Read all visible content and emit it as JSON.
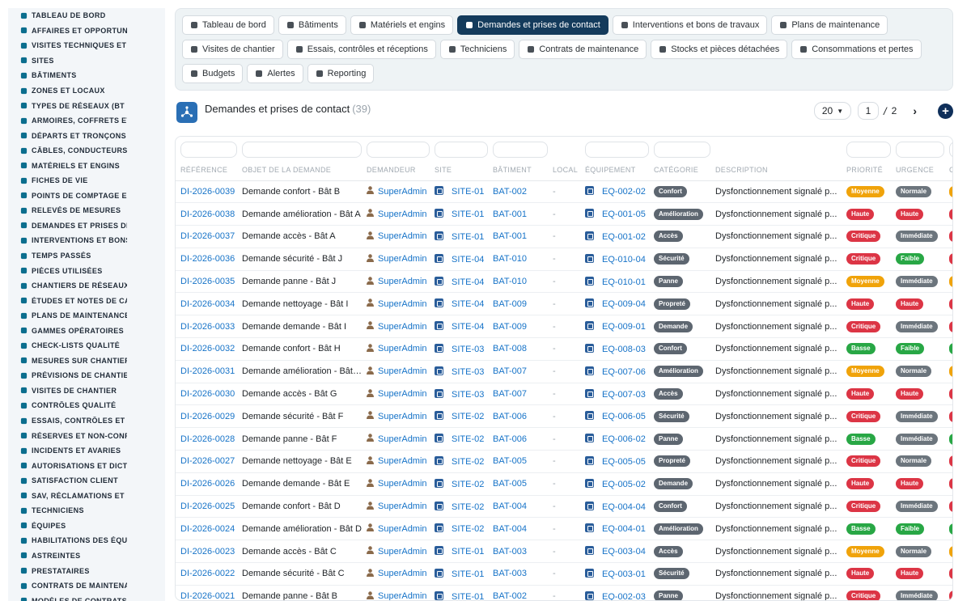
{
  "sidebar": {
    "items": [
      {
        "label": "TABLEAU DE BORD",
        "icon": "gauge-icon"
      },
      {
        "label": "AFFAIRES ET OPPORTUNITÉS",
        "icon": "target-icon"
      },
      {
        "label": "VISITES TECHNIQUES ET AUDITS",
        "icon": "clipboard-icon"
      },
      {
        "label": "SITES",
        "icon": "map-pin-icon"
      },
      {
        "label": "BÂTIMENTS",
        "icon": "building-icon"
      },
      {
        "label": "ZONES ET LOCAUX",
        "icon": "grid-icon"
      },
      {
        "label": "TYPES DE RÉSEAUX (BT / HTA)",
        "icon": "network-icon"
      },
      {
        "label": "ARMOIRES, COFFRETS ET TGBT",
        "icon": "cabinet-icon"
      },
      {
        "label": "DÉPARTS ET TRONÇONS",
        "icon": "route-icon"
      },
      {
        "label": "CÂBLES, CONDUCTEURS",
        "icon": "cable-icon"
      },
      {
        "label": "MATÉRIELS ET ENGINS",
        "icon": "gears-icon"
      },
      {
        "label": "FICHES DE VIE",
        "icon": "file-icon"
      },
      {
        "label": "POINTS DE COMPTAGE ET MESURE",
        "icon": "counter-icon"
      },
      {
        "label": "RELEVÉS DE MESURES",
        "icon": "chart-icon"
      },
      {
        "label": "DEMANDES ET PRISES DE CONTACT",
        "icon": "inbox-icon"
      },
      {
        "label": "INTERVENTIONS ET BONS DE TRAVAUX",
        "icon": "wrench-icon"
      },
      {
        "label": "TEMPS PASSÉS",
        "icon": "clock-icon"
      },
      {
        "label": "PIÈCES UTILISÉES",
        "icon": "box-icon"
      },
      {
        "label": "CHANTIERS DE RÉSEAUX",
        "icon": "hammer-icon"
      },
      {
        "label": "ÉTUDES ET NOTES DE CALCUL",
        "icon": "pencil-icon"
      },
      {
        "label": "PLANS DE MAINTENANCE",
        "icon": "calendar-icon"
      },
      {
        "label": "GAMMES OPÉRATOIRES",
        "icon": "list-icon"
      },
      {
        "label": "CHECK-LISTS QUALITÉ",
        "icon": "checklist-icon"
      },
      {
        "label": "MESURES SUR CHANTIER",
        "icon": "ruler-icon"
      },
      {
        "label": "PRÉVISIONS DE CHANTIER",
        "icon": "forecast-icon"
      },
      {
        "label": "VISITES DE CHANTIER",
        "icon": "walk-icon"
      },
      {
        "label": "CONTRÔLES QUALITÉ",
        "icon": "check-icon"
      },
      {
        "label": "ESSAIS, CONTRÔLES ET RÉCEPTIONS",
        "icon": "doc-check-icon"
      },
      {
        "label": "RÉSERVES ET NON-CONFORMITÉS",
        "icon": "alert-icon"
      },
      {
        "label": "INCIDENTS ET AVARIES",
        "icon": "warning-icon"
      },
      {
        "label": "AUTORISATIONS ET DICT",
        "icon": "stamp-icon"
      },
      {
        "label": "SATISFACTION CLIENT",
        "icon": "smile-icon"
      },
      {
        "label": "SAV, RÉCLAMATIONS ET GARANTIES",
        "icon": "headset-icon"
      },
      {
        "label": "TECHNICIENS",
        "icon": "helmet-icon"
      },
      {
        "label": "ÉQUIPES",
        "icon": "users-icon"
      },
      {
        "label": "HABILITATIONS DES ÉQUIPES",
        "icon": "badge-icon"
      },
      {
        "label": "ASTREINTES",
        "icon": "phone-icon"
      },
      {
        "label": "PRESTATAIRES",
        "icon": "truck-icon"
      },
      {
        "label": "CONTRATS DE MAINTENANCE",
        "icon": "contract-icon"
      },
      {
        "label": "MODÈLES DE CONTRATS",
        "icon": "template-icon"
      }
    ]
  },
  "tabs": [
    {
      "label": "Tableau de bord",
      "icon": "gauge-icon",
      "active": false
    },
    {
      "label": "Bâtiments",
      "icon": "building-icon",
      "active": false
    },
    {
      "label": "Matériels et engins",
      "icon": "gears-icon",
      "active": false
    },
    {
      "label": "Demandes et prises de contact",
      "icon": "question-icon",
      "active": true
    },
    {
      "label": "Interventions et bons de travaux",
      "icon": "clipboard-icon",
      "active": false
    },
    {
      "label": "Plans de maintenance",
      "icon": "calendar-icon",
      "active": false
    },
    {
      "label": "Visites de chantier",
      "icon": "walk-icon",
      "active": false
    },
    {
      "label": "Essais, contrôles et réceptions",
      "icon": "doc-check-icon",
      "active": false
    },
    {
      "label": "Techniciens",
      "icon": "helmet-icon",
      "active": false
    },
    {
      "label": "Contrats de maintenance",
      "icon": "contract-icon",
      "active": false
    },
    {
      "label": "Stocks et pièces détachées",
      "icon": "boxes-icon",
      "active": false
    },
    {
      "label": "Consommations et pertes",
      "icon": "bolt-icon",
      "active": false
    },
    {
      "label": "Budgets",
      "icon": "money-icon",
      "active": false
    },
    {
      "label": "Alertes",
      "icon": "bell-icon",
      "active": false
    },
    {
      "label": "Reporting",
      "icon": "pie-icon",
      "active": false
    }
  ],
  "page": {
    "title": "Demandes et prises de contact",
    "count": "(39)",
    "icon": "hub-icon"
  },
  "pager": {
    "page_size": "20",
    "current_page": "1",
    "separator": "/",
    "total_pages": "2",
    "next": "›",
    "add": "+"
  },
  "table": {
    "columns": [
      "RÉFÉRENCE",
      "OBJET DE LA DEMANDE",
      "DEMANDEUR",
      "SITE",
      "BÂTIMENT",
      "LOCAL",
      "ÉQUIPEMENT",
      "CATÉGORIE",
      "DESCRIPTION",
      "PRIORITÉ",
      "URGENCE",
      "C"
    ],
    "rows": [
      {
        "ref": "DI-2026-0039",
        "objet": "Demande confort - Bât B",
        "demandeur": "SuperAdmin",
        "site": "SITE-01",
        "batiment": "BAT-002",
        "local": "-",
        "equipement": "EQ-002-02",
        "categorie": "Confort",
        "description": "Dysfonctionnement signalé p...",
        "priorite": "Moyenne",
        "urgence": "Normale"
      },
      {
        "ref": "DI-2026-0038",
        "objet": "Demande amélioration - Bât A",
        "demandeur": "SuperAdmin",
        "site": "SITE-01",
        "batiment": "BAT-001",
        "local": "-",
        "equipement": "EQ-001-05",
        "categorie": "Amélioration",
        "description": "Dysfonctionnement signalé p...",
        "priorite": "Haute",
        "urgence": "Haute"
      },
      {
        "ref": "DI-2026-0037",
        "objet": "Demande accès - Bât A",
        "demandeur": "SuperAdmin",
        "site": "SITE-01",
        "batiment": "BAT-001",
        "local": "-",
        "equipement": "EQ-001-02",
        "categorie": "Accès",
        "description": "Dysfonctionnement signalé p...",
        "priorite": "Critique",
        "urgence": "Immédiate"
      },
      {
        "ref": "DI-2026-0036",
        "objet": "Demande sécurité - Bât J",
        "demandeur": "SuperAdmin",
        "site": "SITE-04",
        "batiment": "BAT-010",
        "local": "-",
        "equipement": "EQ-010-04",
        "categorie": "Sécurité",
        "description": "Dysfonctionnement signalé p...",
        "priorite": "Critique",
        "urgence": "Faible"
      },
      {
        "ref": "DI-2026-0035",
        "objet": "Demande panne - Bât J",
        "demandeur": "SuperAdmin",
        "site": "SITE-04",
        "batiment": "BAT-010",
        "local": "-",
        "equipement": "EQ-010-01",
        "categorie": "Panne",
        "description": "Dysfonctionnement signalé p...",
        "priorite": "Moyenne",
        "urgence": "Immédiate"
      },
      {
        "ref": "DI-2026-0034",
        "objet": "Demande nettoyage - Bât I",
        "demandeur": "SuperAdmin",
        "site": "SITE-04",
        "batiment": "BAT-009",
        "local": "-",
        "equipement": "EQ-009-04",
        "categorie": "Propreté",
        "description": "Dysfonctionnement signalé p...",
        "priorite": "Haute",
        "urgence": "Haute"
      },
      {
        "ref": "DI-2026-0033",
        "objet": "Demande demande - Bât I",
        "demandeur": "SuperAdmin",
        "site": "SITE-04",
        "batiment": "BAT-009",
        "local": "-",
        "equipement": "EQ-009-01",
        "categorie": "Demande",
        "description": "Dysfonctionnement signalé p...",
        "priorite": "Critique",
        "urgence": "Immédiate"
      },
      {
        "ref": "DI-2026-0032",
        "objet": "Demande confort - Bât H",
        "demandeur": "SuperAdmin",
        "site": "SITE-03",
        "batiment": "BAT-008",
        "local": "-",
        "equipement": "EQ-008-03",
        "categorie": "Confort",
        "description": "Dysfonctionnement signalé p...",
        "priorite": "Basse",
        "urgence": "Faible"
      },
      {
        "ref": "DI-2026-0031",
        "objet": "Demande amélioration - Bât G",
        "demandeur": "SuperAdmin",
        "site": "SITE-03",
        "batiment": "BAT-007",
        "local": "-",
        "equipement": "EQ-007-06",
        "categorie": "Amélioration",
        "description": "Dysfonctionnement signalé p...",
        "priorite": "Moyenne",
        "urgence": "Normale"
      },
      {
        "ref": "DI-2026-0030",
        "objet": "Demande accès - Bât G",
        "demandeur": "SuperAdmin",
        "site": "SITE-03",
        "batiment": "BAT-007",
        "local": "-",
        "equipement": "EQ-007-03",
        "categorie": "Accès",
        "description": "Dysfonctionnement signalé p...",
        "priorite": "Haute",
        "urgence": "Haute"
      },
      {
        "ref": "DI-2026-0029",
        "objet": "Demande sécurité - Bât F",
        "demandeur": "SuperAdmin",
        "site": "SITE-02",
        "batiment": "BAT-006",
        "local": "-",
        "equipement": "EQ-006-05",
        "categorie": "Sécurité",
        "description": "Dysfonctionnement signalé p...",
        "priorite": "Critique",
        "urgence": "Immédiate"
      },
      {
        "ref": "DI-2026-0028",
        "objet": "Demande panne - Bât F",
        "demandeur": "SuperAdmin",
        "site": "SITE-02",
        "batiment": "BAT-006",
        "local": "-",
        "equipement": "EQ-006-02",
        "categorie": "Panne",
        "description": "Dysfonctionnement signalé p...",
        "priorite": "Basse",
        "urgence": "Immédiate"
      },
      {
        "ref": "DI-2026-0027",
        "objet": "Demande nettoyage - Bât E",
        "demandeur": "SuperAdmin",
        "site": "SITE-02",
        "batiment": "BAT-005",
        "local": "-",
        "equipement": "EQ-005-05",
        "categorie": "Propreté",
        "description": "Dysfonctionnement signalé p...",
        "priorite": "Critique",
        "urgence": "Normale"
      },
      {
        "ref": "DI-2026-0026",
        "objet": "Demande demande - Bât E",
        "demandeur": "SuperAdmin",
        "site": "SITE-02",
        "batiment": "BAT-005",
        "local": "-",
        "equipement": "EQ-005-02",
        "categorie": "Demande",
        "description": "Dysfonctionnement signalé p...",
        "priorite": "Haute",
        "urgence": "Haute"
      },
      {
        "ref": "DI-2026-0025",
        "objet": "Demande confort - Bât D",
        "demandeur": "SuperAdmin",
        "site": "SITE-02",
        "batiment": "BAT-004",
        "local": "-",
        "equipement": "EQ-004-04",
        "categorie": "Confort",
        "description": "Dysfonctionnement signalé p...",
        "priorite": "Critique",
        "urgence": "Immédiate"
      },
      {
        "ref": "DI-2026-0024",
        "objet": "Demande amélioration - Bât D",
        "demandeur": "SuperAdmin",
        "site": "SITE-02",
        "batiment": "BAT-004",
        "local": "-",
        "equipement": "EQ-004-01",
        "categorie": "Amélioration",
        "description": "Dysfonctionnement signalé p...",
        "priorite": "Basse",
        "urgence": "Faible"
      },
      {
        "ref": "DI-2026-0023",
        "objet": "Demande accès - Bât C",
        "demandeur": "SuperAdmin",
        "site": "SITE-01",
        "batiment": "BAT-003",
        "local": "-",
        "equipement": "EQ-003-04",
        "categorie": "Accès",
        "description": "Dysfonctionnement signalé p...",
        "priorite": "Moyenne",
        "urgence": "Normale"
      },
      {
        "ref": "DI-2026-0022",
        "objet": "Demande sécurité - Bât C",
        "demandeur": "SuperAdmin",
        "site": "SITE-01",
        "batiment": "BAT-003",
        "local": "-",
        "equipement": "EQ-003-01",
        "categorie": "Sécurité",
        "description": "Dysfonctionnement signalé p...",
        "priorite": "Haute",
        "urgence": "Haute"
      },
      {
        "ref": "DI-2026-0021",
        "objet": "Demande panne - Bât B",
        "demandeur": "SuperAdmin",
        "site": "SITE-01",
        "batiment": "BAT-002",
        "local": "-",
        "equipement": "EQ-002-03",
        "categorie": "Panne",
        "description": "Dysfonctionnement signalé p...",
        "priorite": "Critique",
        "urgence": "Immédiate"
      }
    ]
  },
  "colors": {
    "accent": "#143b5c",
    "link": "#1673c8",
    "sidebar_icon": "#0b6e8e",
    "priorite": {
      "Moyenne": "#f0a30a",
      "Haute": "#dc3545",
      "Critique": "#dc3545",
      "Basse": "#28a745"
    },
    "urgence": {
      "Normale": "#6c757d",
      "Haute": "#dc3545",
      "Immédiate": "#6c757d",
      "Faible": "#28a745"
    },
    "categorie": "#5d6670"
  }
}
